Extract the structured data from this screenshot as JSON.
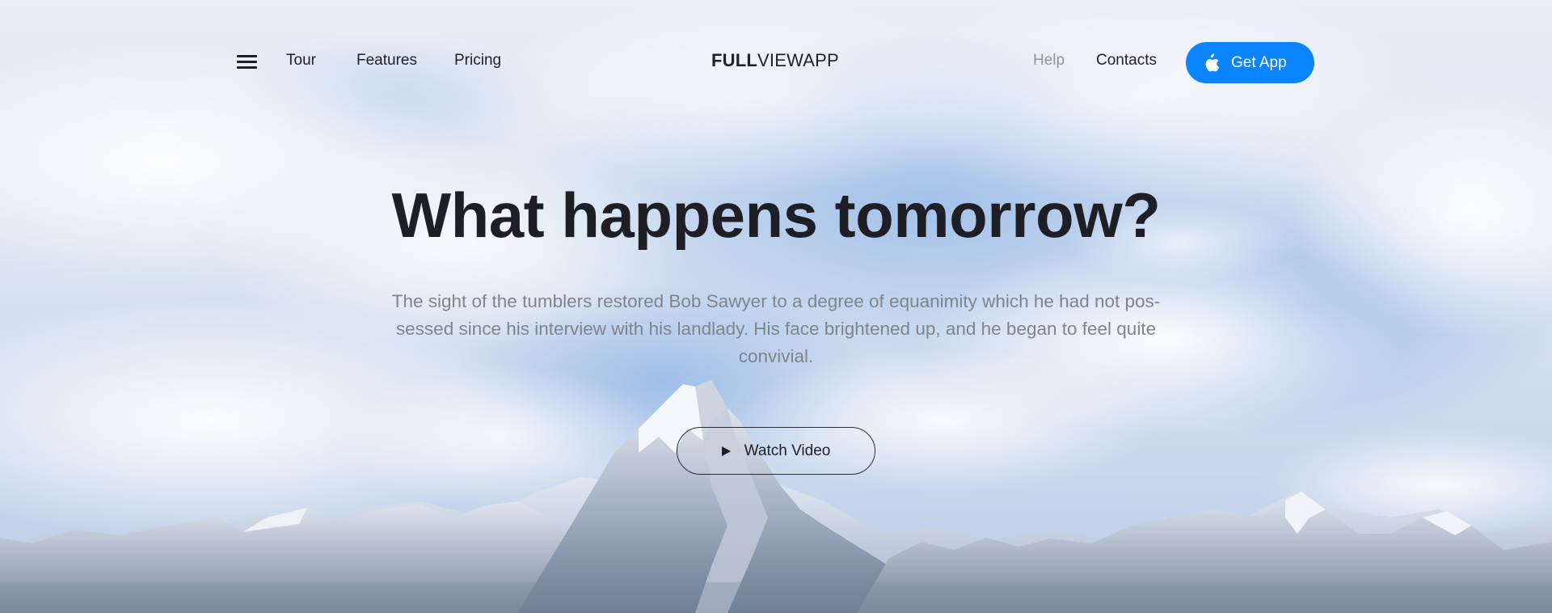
{
  "nav": {
    "left_links": [
      "Tour",
      "Features",
      "Pricing"
    ],
    "logo_bold": "FULL",
    "logo_light": "VIEWAPP",
    "right_links": [
      "Help",
      "Contacts"
    ],
    "get_app_label": "Get App"
  },
  "hero": {
    "headline": "What happens tomorrow?",
    "subtitle_lines": [
      "The sight of the tumblers restored Bob Sawyer to a degree of equanimity which he had not pos-",
      "sessed since his interview with his landlady. His face brightened up, and he began to feel quite",
      "convivial."
    ],
    "watch_video_label": "Watch Video"
  },
  "colors": {
    "primary_button": "#0a84ff",
    "heading_text": "#1e1f26",
    "body_text": "#7f848e",
    "muted_link": "#8f95a0"
  },
  "icons": {
    "menu": "hamburger-menu-icon",
    "app_store": "apple-icon",
    "play": "play-icon"
  }
}
